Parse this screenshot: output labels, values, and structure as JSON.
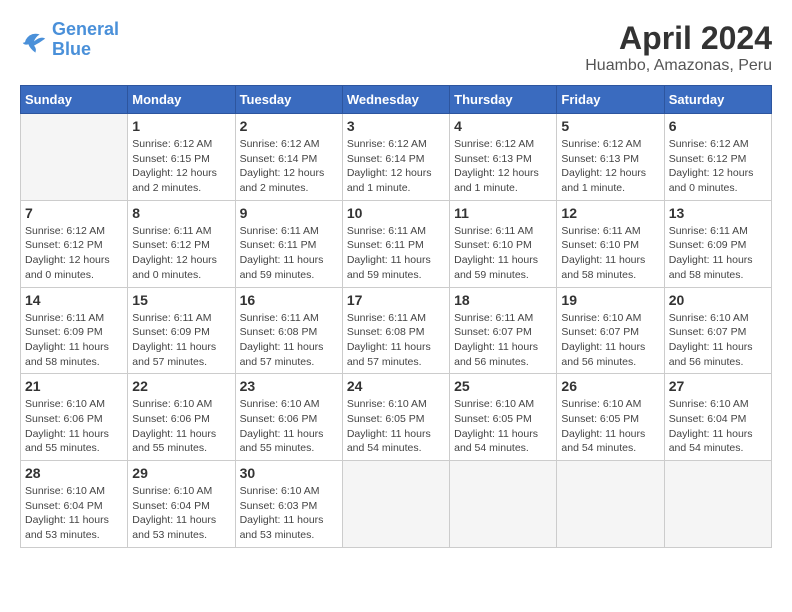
{
  "logo": {
    "general": "General",
    "blue": "Blue"
  },
  "title": "April 2024",
  "location": "Huambo, Amazonas, Peru",
  "weekdays": [
    "Sunday",
    "Monday",
    "Tuesday",
    "Wednesday",
    "Thursday",
    "Friday",
    "Saturday"
  ],
  "weeks": [
    [
      {
        "day": "",
        "info": ""
      },
      {
        "day": "1",
        "info": "Sunrise: 6:12 AM\nSunset: 6:15 PM\nDaylight: 12 hours\nand 2 minutes."
      },
      {
        "day": "2",
        "info": "Sunrise: 6:12 AM\nSunset: 6:14 PM\nDaylight: 12 hours\nand 2 minutes."
      },
      {
        "day": "3",
        "info": "Sunrise: 6:12 AM\nSunset: 6:14 PM\nDaylight: 12 hours\nand 1 minute."
      },
      {
        "day": "4",
        "info": "Sunrise: 6:12 AM\nSunset: 6:13 PM\nDaylight: 12 hours\nand 1 minute."
      },
      {
        "day": "5",
        "info": "Sunrise: 6:12 AM\nSunset: 6:13 PM\nDaylight: 12 hours\nand 1 minute."
      },
      {
        "day": "6",
        "info": "Sunrise: 6:12 AM\nSunset: 6:12 PM\nDaylight: 12 hours\nand 0 minutes."
      }
    ],
    [
      {
        "day": "7",
        "info": "Sunrise: 6:12 AM\nSunset: 6:12 PM\nDaylight: 12 hours\nand 0 minutes."
      },
      {
        "day": "8",
        "info": "Sunrise: 6:11 AM\nSunset: 6:12 PM\nDaylight: 12 hours\nand 0 minutes."
      },
      {
        "day": "9",
        "info": "Sunrise: 6:11 AM\nSunset: 6:11 PM\nDaylight: 11 hours\nand 59 minutes."
      },
      {
        "day": "10",
        "info": "Sunrise: 6:11 AM\nSunset: 6:11 PM\nDaylight: 11 hours\nand 59 minutes."
      },
      {
        "day": "11",
        "info": "Sunrise: 6:11 AM\nSunset: 6:10 PM\nDaylight: 11 hours\nand 59 minutes."
      },
      {
        "day": "12",
        "info": "Sunrise: 6:11 AM\nSunset: 6:10 PM\nDaylight: 11 hours\nand 58 minutes."
      },
      {
        "day": "13",
        "info": "Sunrise: 6:11 AM\nSunset: 6:09 PM\nDaylight: 11 hours\nand 58 minutes."
      }
    ],
    [
      {
        "day": "14",
        "info": "Sunrise: 6:11 AM\nSunset: 6:09 PM\nDaylight: 11 hours\nand 58 minutes."
      },
      {
        "day": "15",
        "info": "Sunrise: 6:11 AM\nSunset: 6:09 PM\nDaylight: 11 hours\nand 57 minutes."
      },
      {
        "day": "16",
        "info": "Sunrise: 6:11 AM\nSunset: 6:08 PM\nDaylight: 11 hours\nand 57 minutes."
      },
      {
        "day": "17",
        "info": "Sunrise: 6:11 AM\nSunset: 6:08 PM\nDaylight: 11 hours\nand 57 minutes."
      },
      {
        "day": "18",
        "info": "Sunrise: 6:11 AM\nSunset: 6:07 PM\nDaylight: 11 hours\nand 56 minutes."
      },
      {
        "day": "19",
        "info": "Sunrise: 6:10 AM\nSunset: 6:07 PM\nDaylight: 11 hours\nand 56 minutes."
      },
      {
        "day": "20",
        "info": "Sunrise: 6:10 AM\nSunset: 6:07 PM\nDaylight: 11 hours\nand 56 minutes."
      }
    ],
    [
      {
        "day": "21",
        "info": "Sunrise: 6:10 AM\nSunset: 6:06 PM\nDaylight: 11 hours\nand 55 minutes."
      },
      {
        "day": "22",
        "info": "Sunrise: 6:10 AM\nSunset: 6:06 PM\nDaylight: 11 hours\nand 55 minutes."
      },
      {
        "day": "23",
        "info": "Sunrise: 6:10 AM\nSunset: 6:06 PM\nDaylight: 11 hours\nand 55 minutes."
      },
      {
        "day": "24",
        "info": "Sunrise: 6:10 AM\nSunset: 6:05 PM\nDaylight: 11 hours\nand 54 minutes."
      },
      {
        "day": "25",
        "info": "Sunrise: 6:10 AM\nSunset: 6:05 PM\nDaylight: 11 hours\nand 54 minutes."
      },
      {
        "day": "26",
        "info": "Sunrise: 6:10 AM\nSunset: 6:05 PM\nDaylight: 11 hours\nand 54 minutes."
      },
      {
        "day": "27",
        "info": "Sunrise: 6:10 AM\nSunset: 6:04 PM\nDaylight: 11 hours\nand 54 minutes."
      }
    ],
    [
      {
        "day": "28",
        "info": "Sunrise: 6:10 AM\nSunset: 6:04 PM\nDaylight: 11 hours\nand 53 minutes."
      },
      {
        "day": "29",
        "info": "Sunrise: 6:10 AM\nSunset: 6:04 PM\nDaylight: 11 hours\nand 53 minutes."
      },
      {
        "day": "30",
        "info": "Sunrise: 6:10 AM\nSunset: 6:03 PM\nDaylight: 11 hours\nand 53 minutes."
      },
      {
        "day": "",
        "info": ""
      },
      {
        "day": "",
        "info": ""
      },
      {
        "day": "",
        "info": ""
      },
      {
        "day": "",
        "info": ""
      }
    ]
  ]
}
